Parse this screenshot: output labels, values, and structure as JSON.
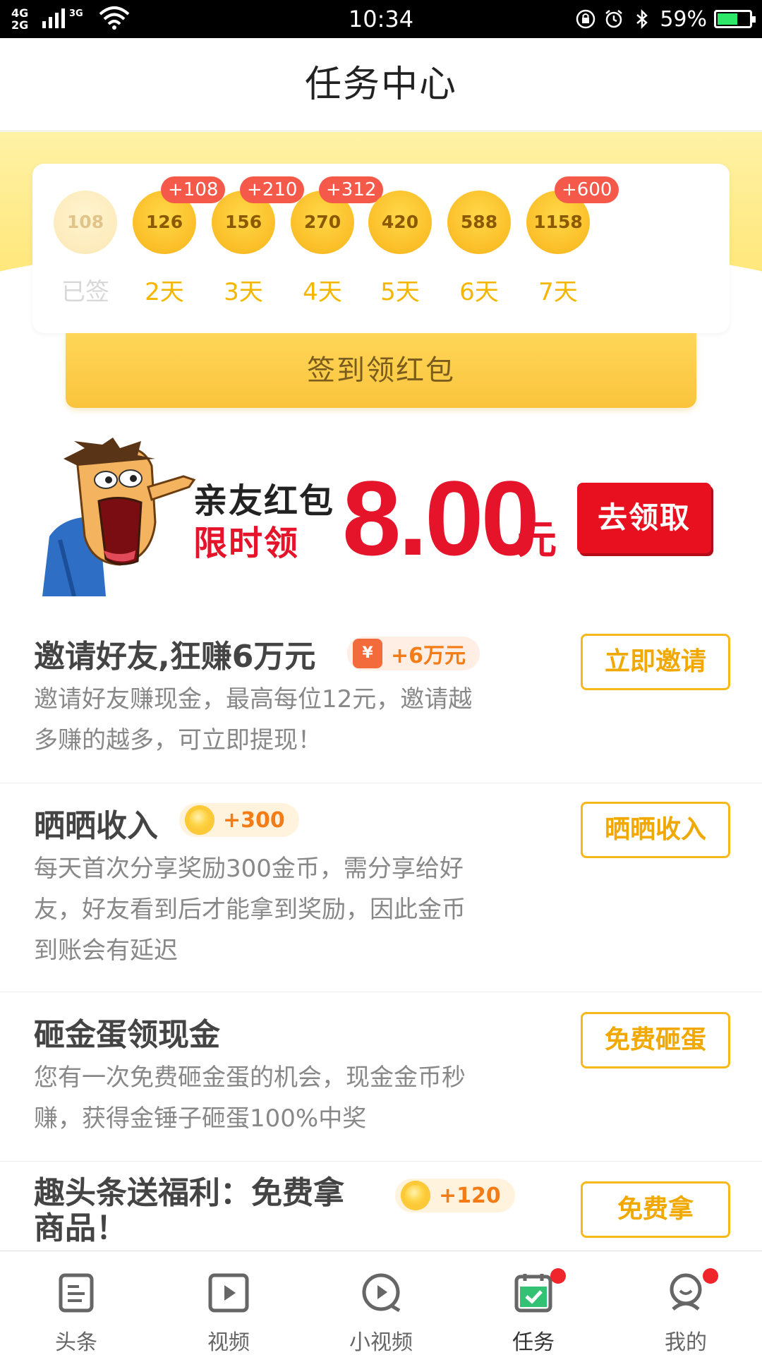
{
  "status_bar": {
    "network_top": "4G",
    "network_bottom": "2G",
    "network_3g": "3G",
    "time": "10:34",
    "battery_percent": "59%",
    "battery_level": 0.59
  },
  "header": {
    "title": "任务中心"
  },
  "signin": {
    "days": [
      {
        "coins": "108",
        "label": "已签",
        "bonus": "",
        "done": true
      },
      {
        "coins": "126",
        "label": "2天",
        "bonus": "+108",
        "done": false
      },
      {
        "coins": "156",
        "label": "3天",
        "bonus": "+210",
        "done": false
      },
      {
        "coins": "270",
        "label": "4天",
        "bonus": "+312",
        "done": false
      },
      {
        "coins": "420",
        "label": "5天",
        "bonus": "",
        "done": false
      },
      {
        "coins": "588",
        "label": "6天",
        "bonus": "",
        "done": false
      },
      {
        "coins": "1158",
        "label": "7天",
        "bonus": "+600",
        "done": false
      }
    ],
    "button_label": "签到领红包"
  },
  "promo": {
    "line1": "亲友红包",
    "line2": "限时领",
    "amount": "8.00",
    "unit": "元",
    "button_label": "去领取"
  },
  "tasks": [
    {
      "title": "邀请好友,狂赚6万元",
      "reward": "+6万元",
      "reward_icon": "yen-icon",
      "description": "邀请好友赚现金，最高每位12元，邀请越多赚的越多，可立即提现！",
      "button_label": "立即邀请"
    },
    {
      "title": "晒晒收入",
      "reward": "+300",
      "reward_icon": "coin-icon",
      "description": "每天首次分享奖励300金币，需分享给好友，好友看到后才能拿到奖励，因此金币到账会有延迟",
      "button_label": "晒晒收入"
    },
    {
      "title": "砸金蛋领现金",
      "reward": "",
      "description": "您有一次免费砸金蛋的机会，现金金币秒赚，获得金锤子砸蛋100%中奖",
      "button_label": "免费砸蛋"
    },
    {
      "title": "趣头条送福利：免费拿商品！",
      "title_line1": "趣头条送福利：免费拿",
      "title_line2": "商品！",
      "reward": "+120",
      "reward_icon": "coin-icon",
      "button_label": "免费拿"
    }
  ],
  "bottom_nav": [
    {
      "label": "头条",
      "icon": "news-icon",
      "badge": false
    },
    {
      "label": "视频",
      "icon": "video-icon",
      "badge": false
    },
    {
      "label": "小视频",
      "icon": "short-video-icon",
      "badge": false
    },
    {
      "label": "任务",
      "icon": "task-icon",
      "badge": true,
      "active": true
    },
    {
      "label": "我的",
      "icon": "profile-icon",
      "badge": true
    }
  ],
  "colors": {
    "accent_yellow": "#f6b91c",
    "accent_red": "#e5142a",
    "badge_red": "#f5594a"
  }
}
